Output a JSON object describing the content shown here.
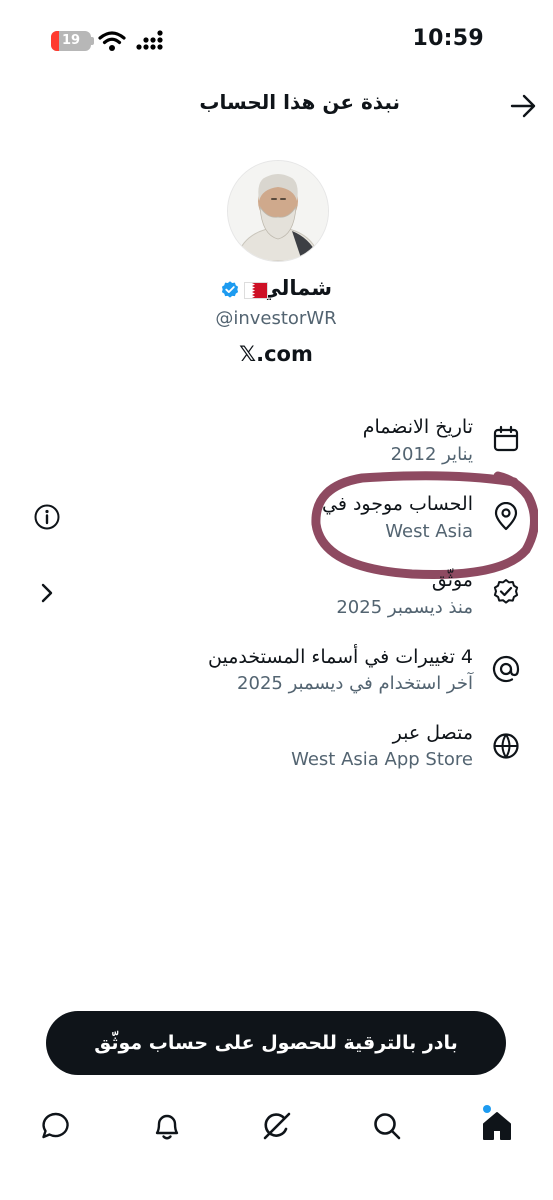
{
  "status_bar": {
    "time": "10:59",
    "battery_level": "19",
    "battery_fraction": 0.19
  },
  "header": {
    "title": "نبذة عن هذا الحساب"
  },
  "profile": {
    "name": "شمالي",
    "handle": "@investorWR",
    "site": "𝕏.com",
    "flag_icon": "bahrain-flag-icon",
    "verified_color": "#1d9bf0"
  },
  "rows": [
    {
      "icon": "calendar-icon",
      "title": "تاريخ الانضمام",
      "value": "يناير 2012"
    },
    {
      "icon": "location-pin-icon",
      "title": "الحساب موجود في",
      "value": "West Asia"
    },
    {
      "icon": "verified-check-icon",
      "title": "موثّق",
      "value": "منذ ديسمبر 2025"
    },
    {
      "icon": "at-sign-icon",
      "title": "4 تغييرات في أسماء المستخدمين",
      "value": "آخر استخدام في ديسمبر 2025"
    },
    {
      "icon": "globe-icon",
      "title": "متصل عبر",
      "value": "West Asia App Store"
    }
  ],
  "cta": {
    "label": "بادر بالترقية للحصول على حساب موثّق"
  },
  "colors": {
    "text": "#0f1419",
    "secondary": "#536471",
    "accent": "#1d9bf0",
    "annotation": "#7a2a45"
  },
  "tabbar": {
    "items": [
      "home-icon",
      "search-icon",
      "grok-icon",
      "notifications-icon",
      "messages-icon"
    ]
  }
}
